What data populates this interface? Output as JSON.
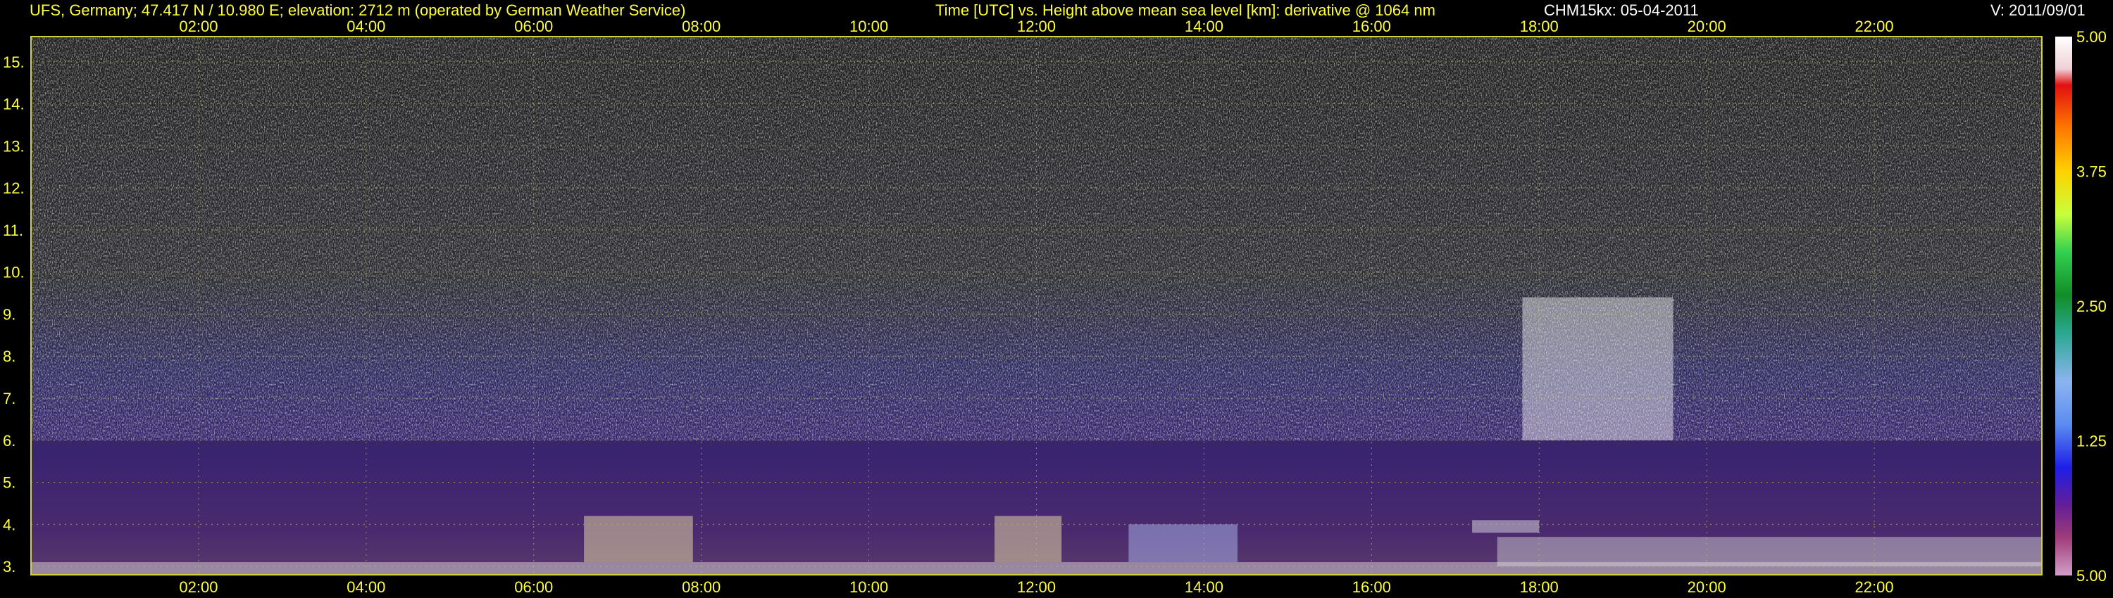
{
  "header": {
    "station": "UFS, Germany; 47.417 N / 10.980 E; elevation: 2712 m  (operated by German Weather Service)",
    "axes_title": "Time [UTC] vs. Height above mean sea level [km]: derivative @ 1064 nm",
    "instrument": "CHM15kx: 05-04-2011",
    "version": "V: 2011/09/01"
  },
  "colors": {
    "axis_text": "#ffff3c",
    "grid": "#c8c832",
    "frame": "#d2d23c"
  },
  "chart_data": {
    "type": "heatmap",
    "title": "Time [UTC] vs. Height above mean sea level [km]: derivative @ 1064 nm",
    "x_ticks": [
      "02:00",
      "04:00",
      "06:00",
      "08:00",
      "10:00",
      "12:00",
      "14:00",
      "16:00",
      "18:00",
      "20:00",
      "22:00"
    ],
    "x_tick_hours": [
      2,
      4,
      6,
      8,
      10,
      12,
      14,
      16,
      18,
      20,
      22
    ],
    "xlim": [
      0,
      24
    ],
    "y_ticks": [
      "3.",
      "4.",
      "5.",
      "6.",
      "7.",
      "8.",
      "9.",
      "10.",
      "11.",
      "12.",
      "13.",
      "14.",
      "15."
    ],
    "y_tick_values": [
      3,
      4,
      5,
      6,
      7,
      8,
      9,
      10,
      11,
      12,
      13,
      14,
      15
    ],
    "ylim": [
      2.8,
      15.6
    ],
    "colorbar": {
      "ticks": [
        "5.00",
        "3.75",
        "2.50",
        "1.25",
        "5.00"
      ],
      "range_label_top": "5.00",
      "range_label_bottom": "5.00"
    },
    "features": [
      {
        "name": "surface layer",
        "time_range": [
          0,
          24
        ],
        "height_range": [
          2.8,
          3.1
        ]
      },
      {
        "name": "bright aerosol layer",
        "time_range": [
          6.6,
          7.9
        ],
        "height_range": [
          3.1,
          4.2
        ]
      },
      {
        "name": "bright aerosol layer",
        "time_range": [
          11.5,
          12.3
        ],
        "height_range": [
          3.1,
          4.2
        ]
      },
      {
        "name": "aerosol plumes",
        "time_range": [
          13.1,
          14.4
        ],
        "height_range": [
          3.1,
          4.0
        ]
      },
      {
        "name": "elevated cloud streaks",
        "time_range": [
          17.8,
          19.6
        ],
        "height_range": [
          6.0,
          9.4
        ]
      },
      {
        "name": "layer at ~3.9 km",
        "time_range": [
          17.2,
          18.0
        ],
        "height_range": [
          3.8,
          4.1
        ]
      },
      {
        "name": "descending layer",
        "time_range": [
          17.5,
          24
        ],
        "height_range": [
          3.0,
          3.7
        ]
      }
    ]
  }
}
